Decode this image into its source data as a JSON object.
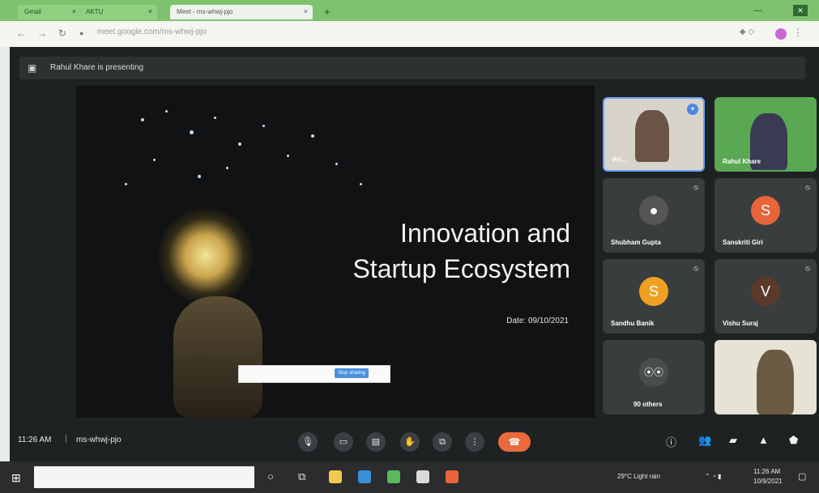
{
  "browser": {
    "tabs": [
      {
        "label": "Gmail"
      },
      {
        "label": "AKTU"
      },
      {
        "label": "Meet - ms-whwj-pjo"
      }
    ],
    "close_symbol": "×",
    "new_tab": "+",
    "url": "meet.google.com/ms-whwj-pjo"
  },
  "meet": {
    "presenting": "Rahul Khare is presenting",
    "slide": {
      "title_line1": "Innovation and",
      "title_line2": "Startup Ecosystem",
      "date": "Date: 09/10/2021",
      "share_button": "Stop sharing"
    },
    "participants": [
      {
        "name": "Pri...",
        "type": "video",
        "pinned": true
      },
      {
        "name": "Rahul Khare",
        "type": "video"
      },
      {
        "name": "Shubham Gupta",
        "type": "photo"
      },
      {
        "name": "Sanskriti Giri",
        "initial": "S",
        "color": "#e8643a"
      },
      {
        "name": "Sandhu Banik",
        "initial": "S",
        "color": "#f0a020"
      },
      {
        "name": "Vishu Suraj",
        "initial": "V",
        "color": "#5a3a2a"
      },
      {
        "name": "90 others",
        "type": "others"
      },
      {
        "name": "",
        "type": "video"
      }
    ],
    "time": "11:26 AM",
    "separator": "|",
    "meeting_code": "ms-whwj-pjo",
    "controls": [
      "mic-icon",
      "camera-icon",
      "captions-icon",
      "hand-icon",
      "present-icon",
      "more-icon"
    ],
    "right_controls": [
      "info-icon",
      "people-icon",
      "chat-icon",
      "activities-icon",
      "security-icon"
    ]
  },
  "taskbar": {
    "weather": "29°C  Light rain",
    "clock": "11:26 AM",
    "date": "10/9/2021"
  },
  "colors": {
    "tabbar": "#7ec270",
    "hangup": "#e96a3a",
    "pin": "#4a86e8"
  }
}
